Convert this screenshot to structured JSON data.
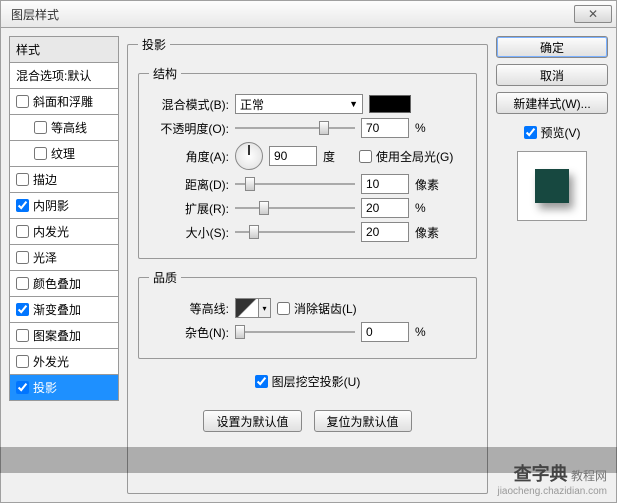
{
  "title": "图层样式",
  "sidebar": {
    "header": "样式",
    "blend_default": "混合选项:默认",
    "items": [
      {
        "label": "斜面和浮雕",
        "checked": false
      },
      {
        "label": "等高线",
        "checked": false,
        "sub": true
      },
      {
        "label": "纹理",
        "checked": false,
        "sub": true
      },
      {
        "label": "描边",
        "checked": false
      },
      {
        "label": "内阴影",
        "checked": true
      },
      {
        "label": "内发光",
        "checked": false
      },
      {
        "label": "光泽",
        "checked": false
      },
      {
        "label": "颜色叠加",
        "checked": false
      },
      {
        "label": "渐变叠加",
        "checked": true
      },
      {
        "label": "图案叠加",
        "checked": false
      },
      {
        "label": "外发光",
        "checked": false
      },
      {
        "label": "投影",
        "checked": true,
        "selected": true
      }
    ]
  },
  "main": {
    "legend": "投影",
    "structure": {
      "legend": "结构",
      "blend_mode_label": "混合模式(B):",
      "blend_mode_value": "正常",
      "opacity_label": "不透明度(O):",
      "opacity_value": "70",
      "opacity_unit": "%",
      "angle_label": "角度(A):",
      "angle_value": "90",
      "angle_unit": "度",
      "global_light": "使用全局光(G)",
      "distance_label": "距离(D):",
      "distance_value": "10",
      "distance_unit": "像素",
      "spread_label": "扩展(R):",
      "spread_value": "20",
      "spread_unit": "%",
      "size_label": "大小(S):",
      "size_value": "20",
      "size_unit": "像素"
    },
    "quality": {
      "legend": "品质",
      "contour_label": "等高线:",
      "antialias": "消除锯齿(L)",
      "noise_label": "杂色(N):",
      "noise_value": "0",
      "noise_unit": "%"
    },
    "knockout": "图层挖空投影(U)",
    "reset_default": "设置为默认值",
    "restore_default": "复位为默认值"
  },
  "right": {
    "ok": "确定",
    "cancel": "取消",
    "new_style": "新建样式(W)...",
    "preview": "预览(V)"
  },
  "watermark": {
    "logo": "查字典",
    "tag": "教程网",
    "url": "jiaocheng.chazidian.com"
  }
}
